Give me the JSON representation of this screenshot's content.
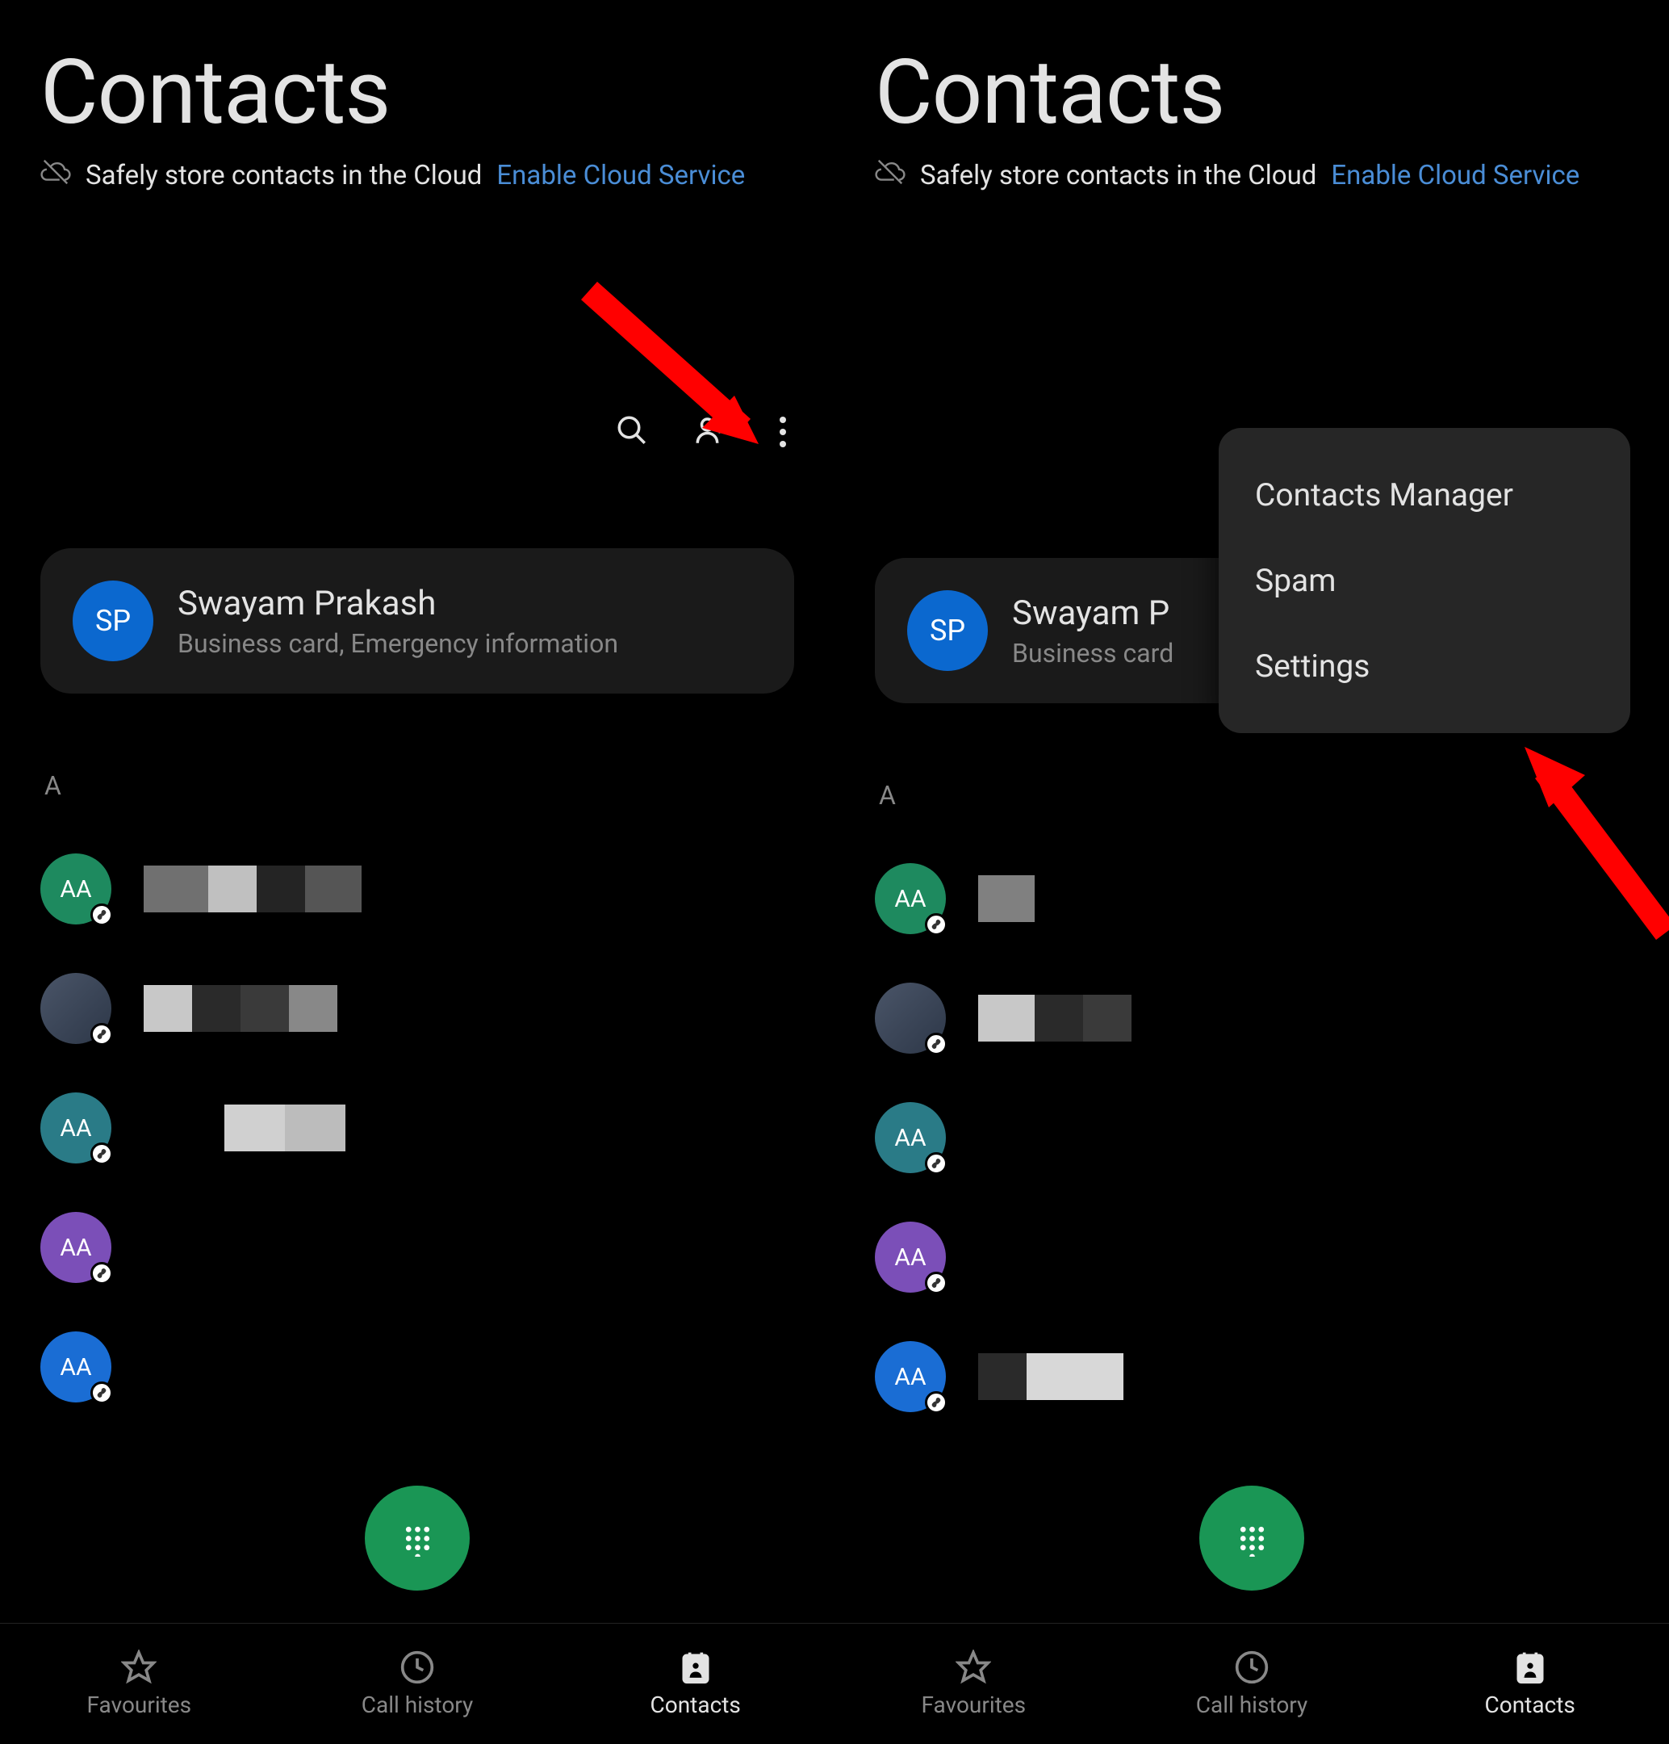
{
  "screen1": {
    "title": "Contacts",
    "cloud_text": "Safely store contacts in the Cloud",
    "cloud_link": "Enable Cloud Service",
    "profile": {
      "initials": "SP",
      "name": "Swayam Prakash",
      "subtitle": "Business card, Emergency information"
    },
    "section_letter": "A",
    "contacts": [
      {
        "initials": "AA",
        "avatar_class": "avatar-green-dark",
        "name_hidden": true
      },
      {
        "initials": "",
        "avatar_class": "avatar-photo",
        "name_hidden": true
      },
      {
        "initials": "AA",
        "avatar_class": "avatar-teal",
        "name_hidden": true
      },
      {
        "initials": "AA",
        "avatar_class": "avatar-purple",
        "name_hidden": true
      },
      {
        "initials": "AA",
        "avatar_class": "avatar-blue2",
        "name_hidden": true
      }
    ],
    "nav": {
      "favourites": "Favourites",
      "call_history": "Call history",
      "contacts": "Contacts"
    }
  },
  "screen2": {
    "title": "Contacts",
    "cloud_text": "Safely store contacts in the Cloud",
    "cloud_link": "Enable Cloud Service",
    "profile": {
      "initials": "SP",
      "name_partial": "Swayam P",
      "subtitle_partial": "Business card"
    },
    "section_letter": "A",
    "menu": {
      "item1": "Contacts Manager",
      "item2": "Spam",
      "item3": "Settings"
    },
    "nav": {
      "favourites": "Favourites",
      "call_history": "Call history",
      "contacts": "Contacts"
    }
  }
}
